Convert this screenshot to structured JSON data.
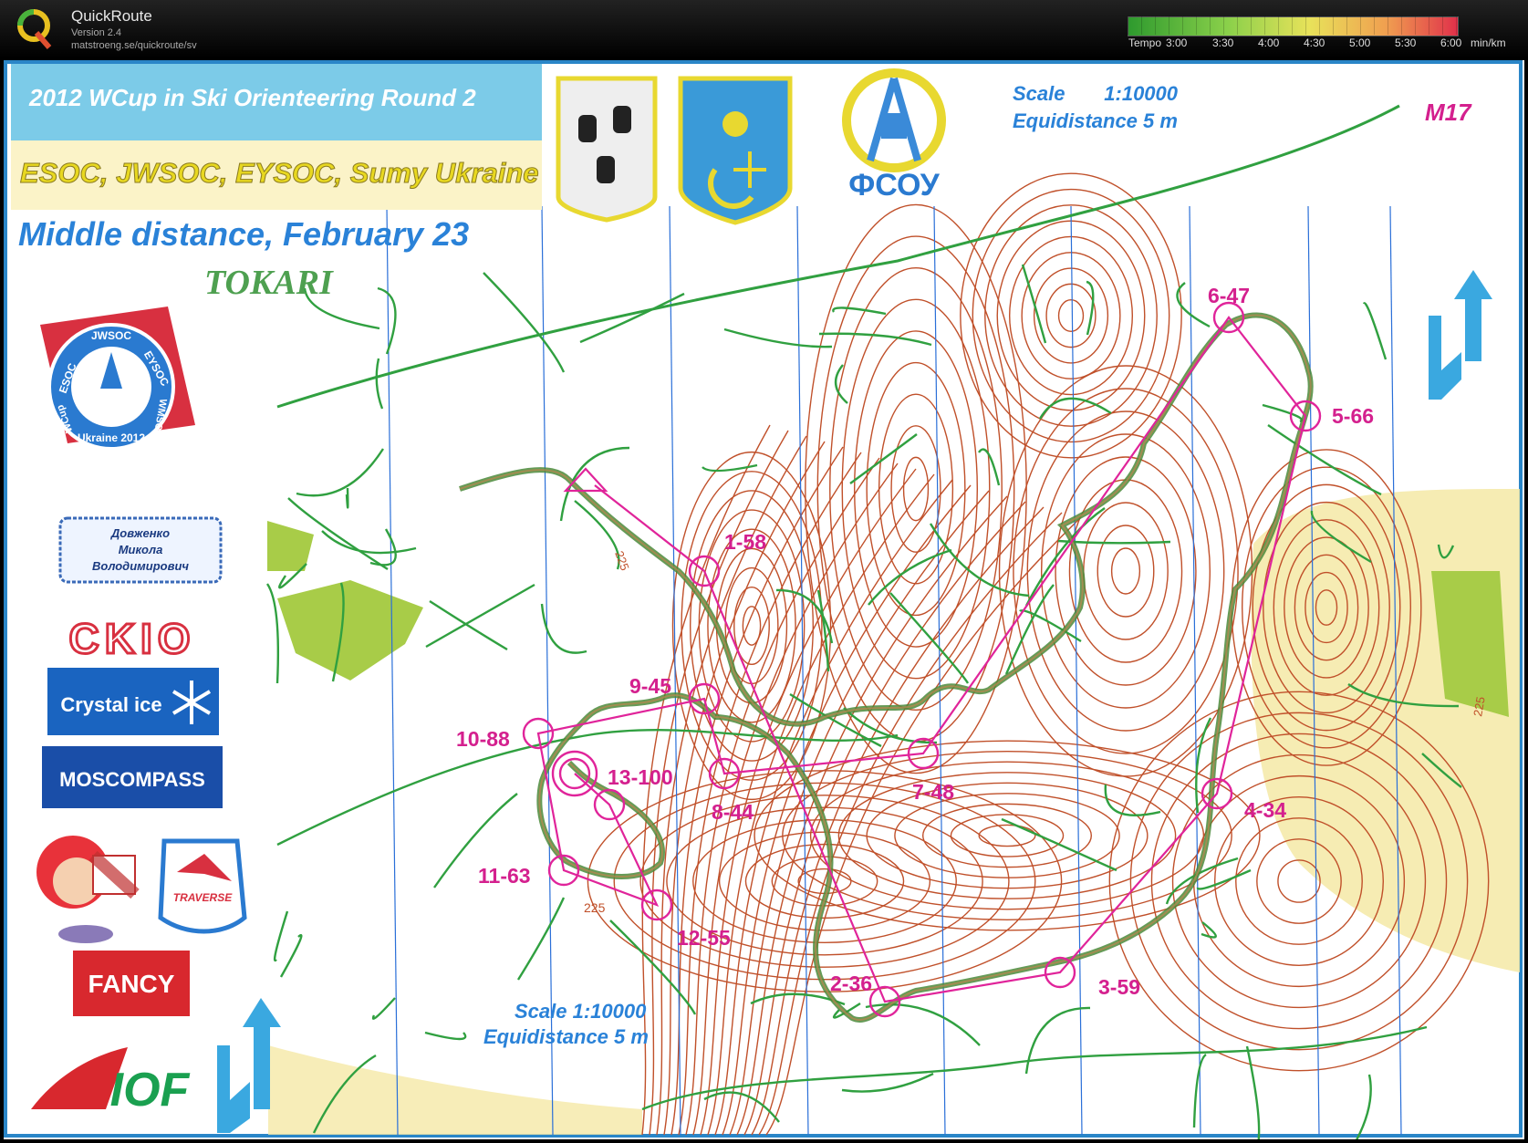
{
  "app": {
    "name": "QuickRoute",
    "version": "Version 2.4",
    "url": "matstroeng.se/quickroute/sv"
  },
  "tempo_legend": {
    "label": "Tempo",
    "ticks": [
      "3:00",
      "3:30",
      "4:00",
      "4:30",
      "5:00",
      "5:30",
      "6:00"
    ],
    "unit": "min/km",
    "colors": [
      "#2e9a2e",
      "#8ad04a",
      "#e8e25a",
      "#f0a050",
      "#e0304a"
    ]
  },
  "map": {
    "banner_title": "2012 WCup in Ski Orienteering Round 2",
    "event_names": "ESOC, JWSOC, EYSOC, Sumy Ukraine",
    "race": "Middle distance, February 23",
    "area": "TOKARI",
    "scale_top": "Scale       1:10000",
    "equidistance_top": "Equidistance  5 m",
    "scale_bottom": "Scale  1:10000",
    "equidistance_bottom": "Equidistance  5 m",
    "class": "M17",
    "contour_labels": [
      "225",
      "225",
      "225"
    ],
    "controls": [
      {
        "label": "1-58"
      },
      {
        "label": "2-36"
      },
      {
        "label": "3-59"
      },
      {
        "label": "4-34"
      },
      {
        "label": "5-66"
      },
      {
        "label": "6-47"
      },
      {
        "label": "7-48"
      },
      {
        "label": "8-44"
      },
      {
        "label": "9-45"
      },
      {
        "label": "10-88"
      },
      {
        "label": "11-63"
      },
      {
        "label": "12-55"
      },
      {
        "label": "13-100"
      }
    ],
    "colors": {
      "course": "#e0249a",
      "route": "#4a8a3a",
      "contour": "#c0502a",
      "trail": "#30a040",
      "magnetic_north": "#2a6fd8",
      "open_land": "#f5e9a6"
    }
  },
  "sponsors": {
    "fsou_text": "ФСОУ",
    "esoc_badge_top": "JWSOC",
    "esoc_badge_left": "ESOC",
    "esoc_badge_right": "EYSOC",
    "esoc_badge_bottom": "Ukraine 2012",
    "esoc_badge_wcup": "WCup",
    "esoc_badge_wmsoc": "WMSOC",
    "dovzhenko": [
      "Довженко",
      "Микола",
      "Володимирович"
    ],
    "ckio": "CKIO",
    "crystal_ice": "Crystal ice",
    "moscompass": "MOSCOMPASS",
    "traverse": "TRAVERSE",
    "fancy": "FANCY",
    "iof": "IOF"
  }
}
